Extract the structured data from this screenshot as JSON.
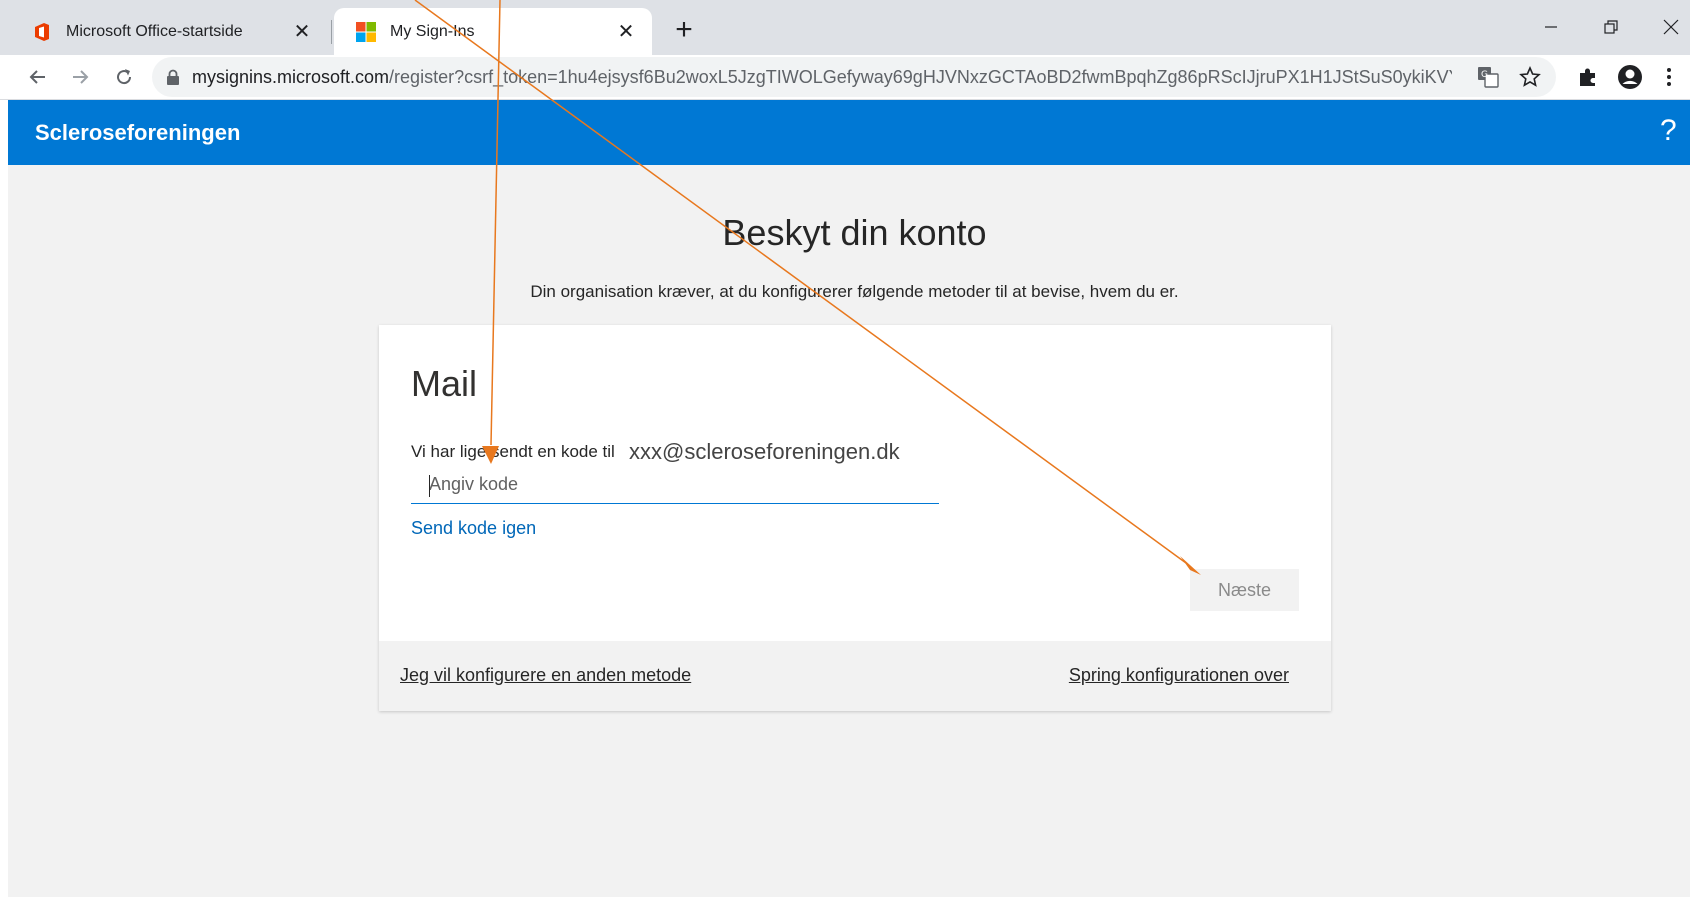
{
  "browser": {
    "tabs": [
      {
        "title": "Microsoft Office-startside",
        "active": false,
        "close": "✕"
      },
      {
        "title": "My Sign-Ins",
        "active": true,
        "close": "✕"
      }
    ],
    "new_tab": "+",
    "url_host": "mysignins.microsoft.com",
    "url_path": "/register?csrf_token=1hu4ejsysf6Bu2woxL5JzgTIWOLGefyway69gHJVNxzGCTAoBD2fwmBpqhZg86pRScIJjruPX1H1JStSuS0ykiKVY..."
  },
  "header": {
    "org_name": "Scleroseforeningen",
    "help": "?"
  },
  "main": {
    "title": "Beskyt din konto",
    "subtitle": "Din organisation kræver, at du konfigurerer følgende metoder til at bevise, hvem du er."
  },
  "card": {
    "title": "Mail",
    "sent_label": "Vi har lige sendt en kode til",
    "email": "xxx@scleroseforeningen.dk",
    "code_placeholder": "Angiv kode",
    "resend": "Send kode igen",
    "next": "Næste",
    "other_method": "Jeg vil konfigurere en anden metode",
    "skip": "Spring konfigurationen over"
  },
  "colors": {
    "brand": "#0078d4",
    "link": "#0067b8",
    "annotation_arrow": "#e8781e"
  }
}
